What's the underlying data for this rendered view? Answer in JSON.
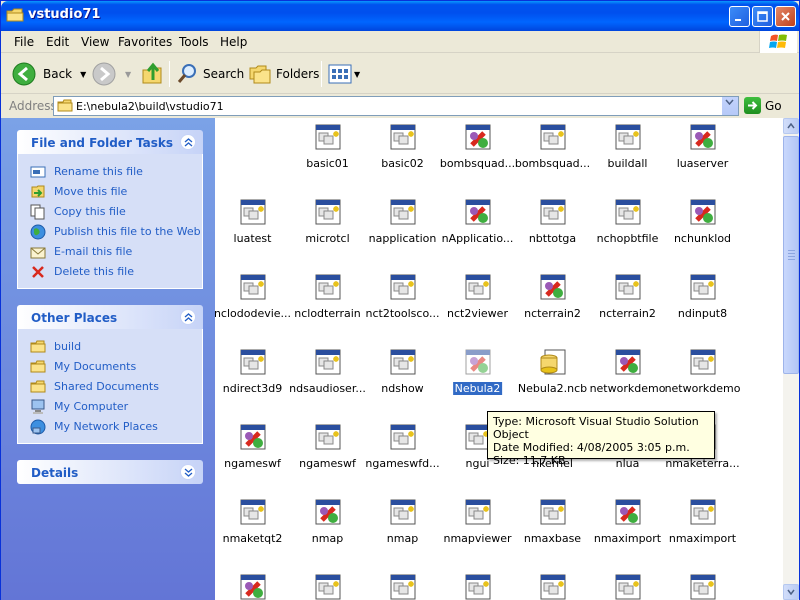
{
  "window": {
    "title": "vstudio71"
  },
  "menu": [
    "File",
    "Edit",
    "View",
    "Favorites",
    "Tools",
    "Help"
  ],
  "toolbar": {
    "back": "Back",
    "search": "Search",
    "folders": "Folders"
  },
  "address": {
    "label": "Address",
    "path": "E:\\nebula2\\build\\vstudio71",
    "go": "Go"
  },
  "file_tasks": {
    "heading": "File and Folder Tasks",
    "items": [
      {
        "label": "Rename this file",
        "icon": "rename-icon"
      },
      {
        "label": "Move this file",
        "icon": "move-icon"
      },
      {
        "label": "Copy this file",
        "icon": "copy-icon"
      },
      {
        "label": "Publish this file to the Web",
        "icon": "globe-icon"
      },
      {
        "label": "E-mail this file",
        "icon": "email-icon"
      },
      {
        "label": "Delete this file",
        "icon": "delete-icon"
      }
    ]
  },
  "other_places": {
    "heading": "Other Places",
    "items": [
      {
        "label": "build",
        "icon": "folder-icon"
      },
      {
        "label": "My Documents",
        "icon": "folder-icon"
      },
      {
        "label": "Shared Documents",
        "icon": "folder-icon"
      },
      {
        "label": "My Computer",
        "icon": "computer-icon"
      },
      {
        "label": "My Network Places",
        "icon": "network-icon"
      }
    ]
  },
  "details": {
    "heading": "Details"
  },
  "files": [
    [
      {
        "n": "basic01",
        "t": "proj"
      },
      {
        "n": "basic02",
        "t": "proj"
      },
      {
        "n": "bombsquad...",
        "t": "sln"
      },
      {
        "n": "bombsquad...",
        "t": "proj"
      },
      {
        "n": "buildall",
        "t": "proj"
      },
      {
        "n": "luaserver",
        "t": "sln"
      }
    ],
    [
      {
        "n": "luatest",
        "t": "proj"
      },
      {
        "n": "microtcl",
        "t": "proj"
      },
      {
        "n": "napplication",
        "t": "proj"
      },
      {
        "n": "nApplicatio...",
        "t": "sln"
      },
      {
        "n": "nbttotga",
        "t": "proj"
      },
      {
        "n": "nchopbtfile",
        "t": "proj"
      },
      {
        "n": "nchunklod",
        "t": "sln"
      }
    ],
    [
      {
        "n": "nclododevie...",
        "t": "proj"
      },
      {
        "n": "nclodterrain",
        "t": "proj"
      },
      {
        "n": "nct2toolsco...",
        "t": "proj"
      },
      {
        "n": "nct2viewer",
        "t": "proj"
      },
      {
        "n": "ncterrain2",
        "t": "sln"
      },
      {
        "n": "ncterrain2",
        "t": "proj"
      },
      {
        "n": "ndinput8",
        "t": "proj"
      }
    ],
    [
      {
        "n": "ndirect3d9",
        "t": "proj"
      },
      {
        "n": "ndsaudioser...",
        "t": "proj"
      },
      {
        "n": "ndshow",
        "t": "proj"
      },
      {
        "n": "Nebula2",
        "t": "sln",
        "selected": true
      },
      {
        "n": "Nebula2.ncb",
        "t": "ncb"
      },
      {
        "n": "networkdemo",
        "t": "sln"
      },
      {
        "n": "networkdemo",
        "t": "proj"
      }
    ],
    [
      {
        "n": "ngameswf",
        "t": "sln"
      },
      {
        "n": "ngameswf",
        "t": "proj"
      },
      {
        "n": "ngameswfd...",
        "t": "proj"
      },
      {
        "n": "ngui",
        "t": "proj"
      },
      {
        "n": "nkernel",
        "t": "proj"
      },
      {
        "n": "nlua",
        "t": "proj"
      },
      {
        "n": "nmaketerra...",
        "t": "proj"
      }
    ],
    [
      {
        "n": "nmaketqt2",
        "t": "proj"
      },
      {
        "n": "nmap",
        "t": "sln"
      },
      {
        "n": "nmap",
        "t": "proj"
      },
      {
        "n": "nmapviewer",
        "t": "proj"
      },
      {
        "n": "nmaxbase",
        "t": "proj"
      },
      {
        "n": "nmaximport",
        "t": "sln"
      },
      {
        "n": "nmaximport",
        "t": "proj"
      }
    ],
    [
      {
        "n": "",
        "t": "sln"
      },
      {
        "n": "",
        "t": "proj"
      },
      {
        "n": "",
        "t": "proj"
      },
      {
        "n": "",
        "t": "proj"
      },
      {
        "n": "",
        "t": "proj"
      },
      {
        "n": "",
        "t": "proj"
      },
      {
        "n": "",
        "t": "proj"
      }
    ]
  ],
  "tooltip": {
    "line1": "Type: Microsoft Visual Studio Solution Object",
    "line2": "Date Modified: 4/08/2005 3:05 p.m.",
    "line3": "Size: 11.7 KB"
  }
}
